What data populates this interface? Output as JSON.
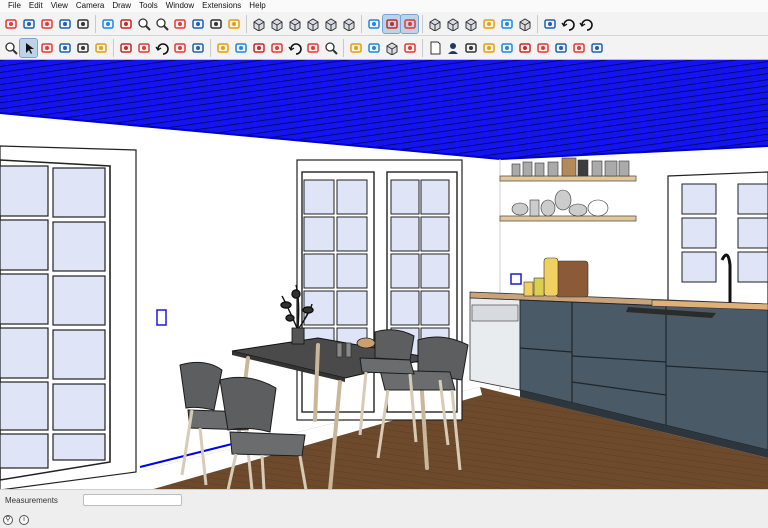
{
  "menubar": {
    "items": [
      "File",
      "Edit",
      "View",
      "Camera",
      "Draw",
      "Tools",
      "Window",
      "Extensions",
      "Help"
    ]
  },
  "toolbar_row1": [
    "make-component-icon",
    "paint-bucket-icon",
    "text-icon",
    "axes-icon",
    "3d-text-icon",
    "sep",
    "section-plane-icon",
    "section-fill-icon",
    "zoom-window-icon",
    "zoom-extents-icon",
    "position-camera-icon",
    "look-around-icon",
    "walk-icon",
    "walk-figure-icon",
    "sep",
    "iso-view-icon",
    "top-view-icon",
    "front-view-icon",
    "right-view-icon",
    "back-view-icon",
    "left-view-icon",
    "sep",
    "xray-icon",
    "back-edges-icon",
    "wireframe-icon",
    "sep",
    "hidden-line-icon",
    "shaded-icon",
    "shaded-texture-icon",
    "monochrome-icon",
    "section-display-icon",
    "box-style-icon",
    "sep",
    "sandbox-icon",
    "rotate-scene-icon",
    "refresh-icon"
  ],
  "toolbar_row2": [
    "zoom-icon",
    "select-icon",
    "eraser-icon",
    "pencil-icon",
    "arc-icon",
    "rectangle-icon",
    "sep",
    "push-pull-icon",
    "follow-me-icon",
    "rotate-icon",
    "scale-icon",
    "offset-icon",
    "sep",
    "tape-measure-icon",
    "dimension-icon",
    "protractor-icon",
    "text-label-icon",
    "orbit-icon",
    "pan-icon",
    "zoom-tool-icon",
    "sep",
    "solid-tools-icon",
    "layers-icon",
    "styles-icon",
    "shadows-icon",
    "sep",
    "page-icon",
    "user-icon",
    "entity-info-icon",
    "line-tool-icon",
    "ruby-console-icon",
    "warehouse-icon",
    "extension-warehouse-icon",
    "layout-icon",
    "ext-red-icon",
    "ext-blue-icon"
  ],
  "status": {
    "measurements_label": "Measurements",
    "measurements_value": "",
    "geo_icon": "geo-location-icon",
    "info_icon": "info-icon"
  },
  "viewport": {
    "ceiling_color": "#1010e6",
    "floor_color": "#6a4a2e",
    "wall_color": "#ffffff",
    "cabinet_color": "#4a5a66",
    "window_glass_color": "#dfe4f7"
  }
}
